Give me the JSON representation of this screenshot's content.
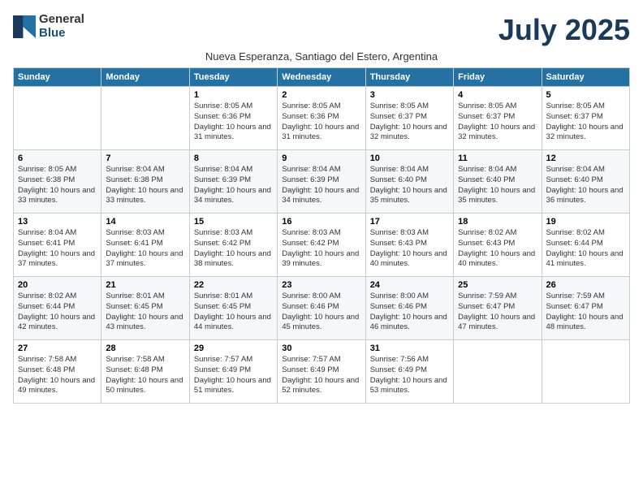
{
  "header": {
    "logo_general": "General",
    "logo_blue": "Blue",
    "month_title": "July 2025",
    "subtitle": "Nueva Esperanza, Santiago del Estero, Argentina"
  },
  "days_of_week": [
    "Sunday",
    "Monday",
    "Tuesday",
    "Wednesday",
    "Thursday",
    "Friday",
    "Saturday"
  ],
  "weeks": [
    [
      {
        "day": "",
        "info": ""
      },
      {
        "day": "",
        "info": ""
      },
      {
        "day": "1",
        "info": "Sunrise: 8:05 AM\nSunset: 6:36 PM\nDaylight: 10 hours and 31 minutes."
      },
      {
        "day": "2",
        "info": "Sunrise: 8:05 AM\nSunset: 6:36 PM\nDaylight: 10 hours and 31 minutes."
      },
      {
        "day": "3",
        "info": "Sunrise: 8:05 AM\nSunset: 6:37 PM\nDaylight: 10 hours and 32 minutes."
      },
      {
        "day": "4",
        "info": "Sunrise: 8:05 AM\nSunset: 6:37 PM\nDaylight: 10 hours and 32 minutes."
      },
      {
        "day": "5",
        "info": "Sunrise: 8:05 AM\nSunset: 6:37 PM\nDaylight: 10 hours and 32 minutes."
      }
    ],
    [
      {
        "day": "6",
        "info": "Sunrise: 8:05 AM\nSunset: 6:38 PM\nDaylight: 10 hours and 33 minutes."
      },
      {
        "day": "7",
        "info": "Sunrise: 8:04 AM\nSunset: 6:38 PM\nDaylight: 10 hours and 33 minutes."
      },
      {
        "day": "8",
        "info": "Sunrise: 8:04 AM\nSunset: 6:39 PM\nDaylight: 10 hours and 34 minutes."
      },
      {
        "day": "9",
        "info": "Sunrise: 8:04 AM\nSunset: 6:39 PM\nDaylight: 10 hours and 34 minutes."
      },
      {
        "day": "10",
        "info": "Sunrise: 8:04 AM\nSunset: 6:40 PM\nDaylight: 10 hours and 35 minutes."
      },
      {
        "day": "11",
        "info": "Sunrise: 8:04 AM\nSunset: 6:40 PM\nDaylight: 10 hours and 35 minutes."
      },
      {
        "day": "12",
        "info": "Sunrise: 8:04 AM\nSunset: 6:40 PM\nDaylight: 10 hours and 36 minutes."
      }
    ],
    [
      {
        "day": "13",
        "info": "Sunrise: 8:04 AM\nSunset: 6:41 PM\nDaylight: 10 hours and 37 minutes."
      },
      {
        "day": "14",
        "info": "Sunrise: 8:03 AM\nSunset: 6:41 PM\nDaylight: 10 hours and 37 minutes."
      },
      {
        "day": "15",
        "info": "Sunrise: 8:03 AM\nSunset: 6:42 PM\nDaylight: 10 hours and 38 minutes."
      },
      {
        "day": "16",
        "info": "Sunrise: 8:03 AM\nSunset: 6:42 PM\nDaylight: 10 hours and 39 minutes."
      },
      {
        "day": "17",
        "info": "Sunrise: 8:03 AM\nSunset: 6:43 PM\nDaylight: 10 hours and 40 minutes."
      },
      {
        "day": "18",
        "info": "Sunrise: 8:02 AM\nSunset: 6:43 PM\nDaylight: 10 hours and 40 minutes."
      },
      {
        "day": "19",
        "info": "Sunrise: 8:02 AM\nSunset: 6:44 PM\nDaylight: 10 hours and 41 minutes."
      }
    ],
    [
      {
        "day": "20",
        "info": "Sunrise: 8:02 AM\nSunset: 6:44 PM\nDaylight: 10 hours and 42 minutes."
      },
      {
        "day": "21",
        "info": "Sunrise: 8:01 AM\nSunset: 6:45 PM\nDaylight: 10 hours and 43 minutes."
      },
      {
        "day": "22",
        "info": "Sunrise: 8:01 AM\nSunset: 6:45 PM\nDaylight: 10 hours and 44 minutes."
      },
      {
        "day": "23",
        "info": "Sunrise: 8:00 AM\nSunset: 6:46 PM\nDaylight: 10 hours and 45 minutes."
      },
      {
        "day": "24",
        "info": "Sunrise: 8:00 AM\nSunset: 6:46 PM\nDaylight: 10 hours and 46 minutes."
      },
      {
        "day": "25",
        "info": "Sunrise: 7:59 AM\nSunset: 6:47 PM\nDaylight: 10 hours and 47 minutes."
      },
      {
        "day": "26",
        "info": "Sunrise: 7:59 AM\nSunset: 6:47 PM\nDaylight: 10 hours and 48 minutes."
      }
    ],
    [
      {
        "day": "27",
        "info": "Sunrise: 7:58 AM\nSunset: 6:48 PM\nDaylight: 10 hours and 49 minutes."
      },
      {
        "day": "28",
        "info": "Sunrise: 7:58 AM\nSunset: 6:48 PM\nDaylight: 10 hours and 50 minutes."
      },
      {
        "day": "29",
        "info": "Sunrise: 7:57 AM\nSunset: 6:49 PM\nDaylight: 10 hours and 51 minutes."
      },
      {
        "day": "30",
        "info": "Sunrise: 7:57 AM\nSunset: 6:49 PM\nDaylight: 10 hours and 52 minutes."
      },
      {
        "day": "31",
        "info": "Sunrise: 7:56 AM\nSunset: 6:49 PM\nDaylight: 10 hours and 53 minutes."
      },
      {
        "day": "",
        "info": ""
      },
      {
        "day": "",
        "info": ""
      }
    ]
  ]
}
